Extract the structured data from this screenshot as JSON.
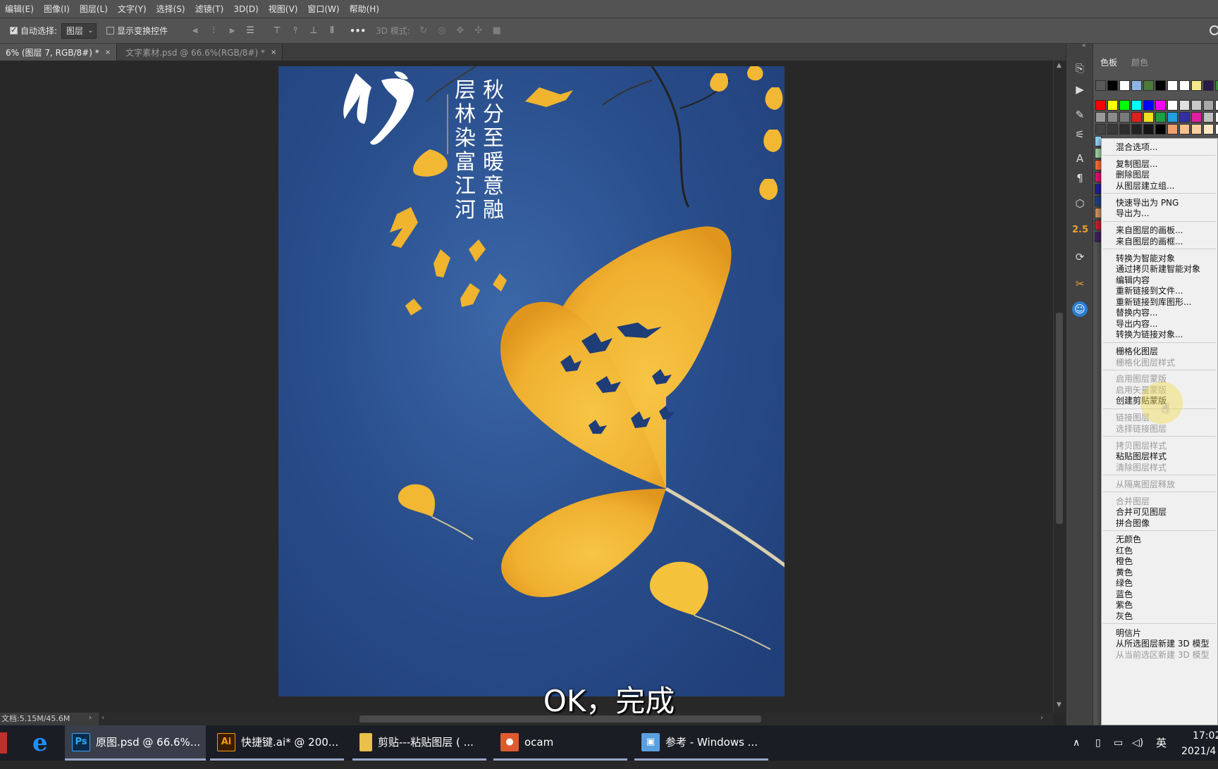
{
  "menubar": [
    "编辑(E)",
    "图像(I)",
    "图层(L)",
    "文字(Y)",
    "选择(S)",
    "滤镜(T)",
    "3D(D)",
    "视图(V)",
    "窗口(W)",
    "帮助(H)"
  ],
  "options": {
    "auto_select_label": "自动选择:",
    "auto_select_value": "图层",
    "show_transform_label": "显示变换控件",
    "more_label": "•••",
    "mode_3d_label": "3D 模式:"
  },
  "tabs": [
    {
      "label": "6% (图层 7, RGB/8#) *",
      "close": "×"
    },
    {
      "label": "文字素材.psd @ 66.6%(RGB/8#) *",
      "close": "×"
    }
  ],
  "poem": {
    "col_right": "秋分至暖意融",
    "col_left": "层林染富江河"
  },
  "status": "文档:5.15M/45.6M",
  "subtitle": "OK，完成",
  "tool_strip": {
    "number_label": "2.5"
  },
  "panel": {
    "tabs": [
      "色板",
      "颜色"
    ],
    "swatch_rows": [
      [
        "#5a5a5a",
        "#000000",
        "#ffffff",
        "#8db4e2",
        "#4e7a3a",
        "#000000",
        "#ffffff",
        "#ffffff",
        "#f5e88a",
        "#2a1a4a",
        "#3a8a3a"
      ],
      [
        "#ff0000",
        "#ffff00",
        "#00ff00",
        "#00ffff",
        "#0000ff",
        "#ff00ff",
        "#ffffff",
        "#e0e0e0",
        "#c8c8c8",
        "#a8a8a8",
        "#ffffff"
      ],
      [
        "#9a9a9a",
        "#8a8a8a",
        "#7a7a7a",
        "#e0201a",
        "#f0e020",
        "#20a040",
        "#20a0e0",
        "#3030a0",
        "#e020a0",
        "#c0c0c0",
        "#ffffff"
      ],
      [
        "#444444",
        "#3a3a3a",
        "#2e2e2e",
        "#222222",
        "#151515",
        "#000000",
        "#f0a070",
        "#f8c090",
        "#f8d0a0",
        "#fce8c0",
        "#ffffff"
      ]
    ],
    "side_swatches": [
      "#8fd0f0",
      "#a0d0a0",
      "#f07030",
      "#e01070",
      "#202090",
      "#204080",
      "#d09060",
      "#c02030",
      "#402060"
    ]
  },
  "context_menu": {
    "items": [
      {
        "label": "混合选项...",
        "enabled": true
      },
      {
        "sep": true
      },
      {
        "label": "复制图层...",
        "enabled": true
      },
      {
        "label": "删除图层",
        "enabled": true
      },
      {
        "label": "从图层建立组...",
        "enabled": true
      },
      {
        "sep": true
      },
      {
        "label": "快速导出为 PNG",
        "enabled": true
      },
      {
        "label": "导出为...",
        "enabled": true
      },
      {
        "sep": true
      },
      {
        "label": "来自图层的画板...",
        "enabled": true
      },
      {
        "label": "来自图层的画框...",
        "enabled": true
      },
      {
        "sep": true
      },
      {
        "label": "转换为智能对象",
        "enabled": true
      },
      {
        "label": "通过拷贝新建智能对象",
        "enabled": true
      },
      {
        "label": "编辑内容",
        "enabled": true
      },
      {
        "label": "重新链接到文件...",
        "enabled": true
      },
      {
        "label": "重新链接到库图形...",
        "enabled": true
      },
      {
        "label": "替换内容...",
        "enabled": true
      },
      {
        "label": "导出内容...",
        "enabled": true
      },
      {
        "label": "转换为链接对象...",
        "enabled": true
      },
      {
        "sep": true
      },
      {
        "label": "栅格化图层",
        "enabled": true
      },
      {
        "label": "栅格化图层样式",
        "enabled": false
      },
      {
        "sep": true
      },
      {
        "label": "启用图层蒙版",
        "enabled": false
      },
      {
        "label": "启用矢量蒙版",
        "enabled": false
      },
      {
        "label": "创建剪贴蒙版",
        "enabled": true
      },
      {
        "sep": true
      },
      {
        "label": "链接图层",
        "enabled": false
      },
      {
        "label": "选择链接图层",
        "enabled": false
      },
      {
        "sep": true
      },
      {
        "label": "拷贝图层样式",
        "enabled": false
      },
      {
        "label": "粘贴图层样式",
        "enabled": true
      },
      {
        "label": "清除图层样式",
        "enabled": false
      },
      {
        "sep": true
      },
      {
        "label": "从隔离图层释放",
        "enabled": false
      },
      {
        "sep": true
      },
      {
        "label": "合并图层",
        "enabled": false
      },
      {
        "label": "合并可见图层",
        "enabled": true
      },
      {
        "label": "拼合图像",
        "enabled": true
      },
      {
        "sep": true
      },
      {
        "label": "无颜色",
        "enabled": true
      },
      {
        "label": "红色",
        "enabled": true
      },
      {
        "label": "橙色",
        "enabled": true
      },
      {
        "label": "黄色",
        "enabled": true
      },
      {
        "label": "绿色",
        "enabled": true
      },
      {
        "label": "蓝色",
        "enabled": true
      },
      {
        "label": "紫色",
        "enabled": true
      },
      {
        "label": "灰色",
        "enabled": true
      },
      {
        "sep": true
      },
      {
        "label": "明信片",
        "enabled": true
      },
      {
        "label": "从所选图层新建 3D 模型",
        "enabled": true
      },
      {
        "label": "从当前选区新建 3D 模型",
        "enabled": false
      }
    ]
  },
  "taskbar": {
    "apps": [
      {
        "icon": "Ps",
        "label": "原图.psd @ 66.6%..."
      },
      {
        "icon": "Ai",
        "label": "快捷键.ai* @ 200..."
      },
      {
        "icon": "folder",
        "label": "剪贴---粘贴图层 ( ..."
      },
      {
        "icon": "ocam",
        "label": "ocam"
      },
      {
        "icon": "image",
        "label": "参考 - Windows ..."
      }
    ],
    "ime": "英",
    "time": "17:02",
    "date": "2021/4"
  }
}
